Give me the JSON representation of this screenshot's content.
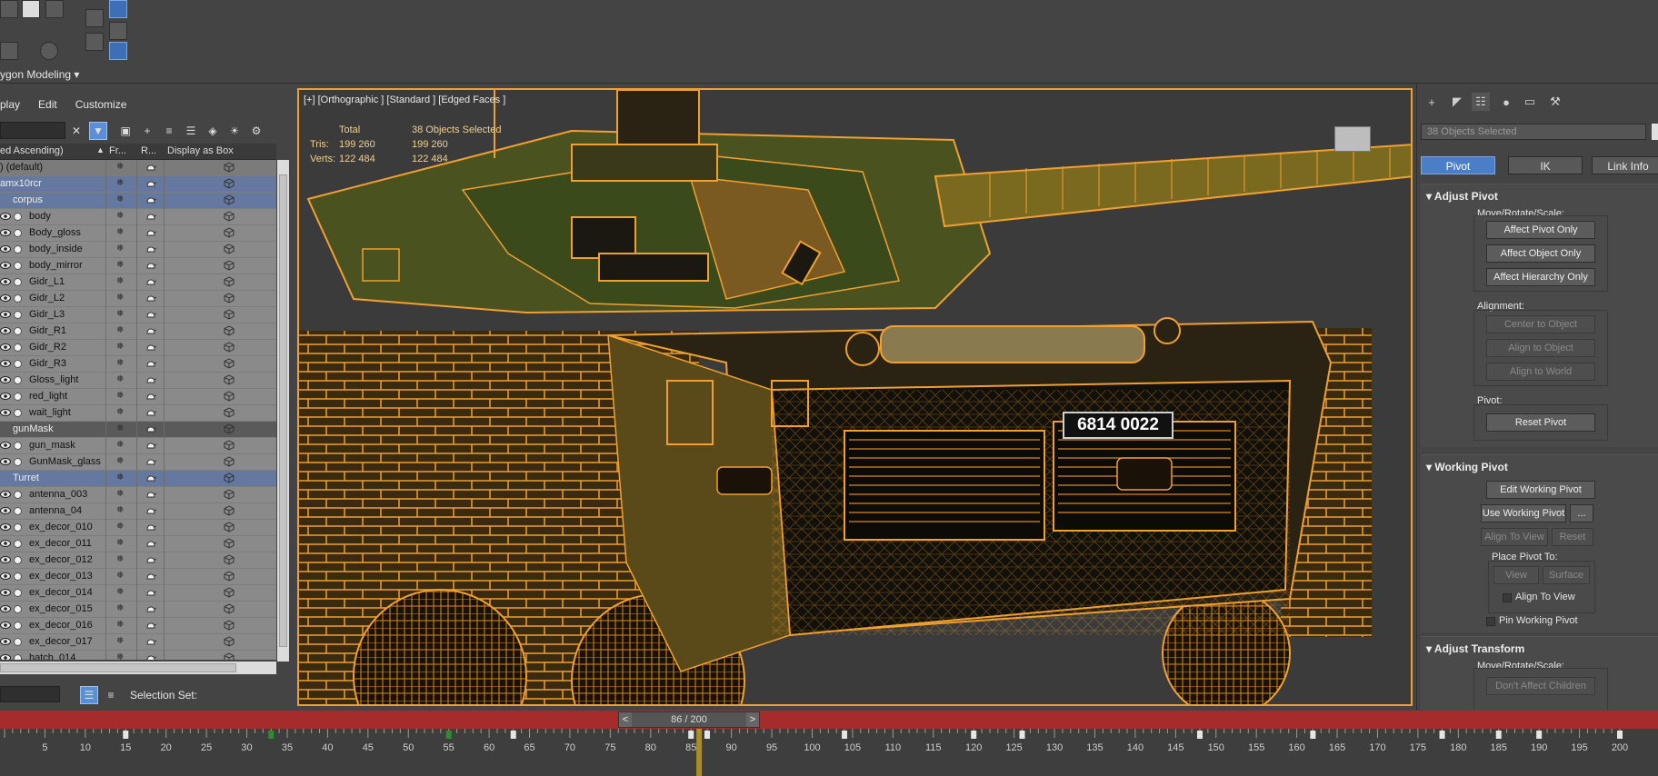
{
  "ribbon": {
    "label": "ygon Modeling",
    "dropdown_icon": "chevron-down-icon"
  },
  "menu": {
    "items": [
      "play",
      "Edit",
      "Customize"
    ]
  },
  "explorer": {
    "columns": [
      "ed Ascending)",
      "Fr...",
      "R...",
      "Display as Box"
    ],
    "rows": [
      {
        "name": ") (default)",
        "type": "layer"
      },
      {
        "name": "amx10rcr",
        "type": "sel"
      },
      {
        "name": "corpus",
        "type": "sel"
      },
      {
        "name": "body",
        "type": "obj"
      },
      {
        "name": "Body_gloss",
        "type": "obj"
      },
      {
        "name": "body_inside",
        "type": "obj"
      },
      {
        "name": "body_mirror",
        "type": "obj"
      },
      {
        "name": "Gidr_L1",
        "type": "obj"
      },
      {
        "name": "Gidr_L2",
        "type": "obj"
      },
      {
        "name": "Gidr_L3",
        "type": "obj"
      },
      {
        "name": "Gidr_R1",
        "type": "obj"
      },
      {
        "name": "Gidr_R2",
        "type": "obj"
      },
      {
        "name": "Gidr_R3",
        "type": "obj"
      },
      {
        "name": "Gloss_light",
        "type": "obj"
      },
      {
        "name": "red_light",
        "type": "obj"
      },
      {
        "name": "wait_light",
        "type": "obj"
      },
      {
        "name": "gunMask",
        "type": "dark"
      },
      {
        "name": "gun_mask",
        "type": "obj"
      },
      {
        "name": "GunMask_glass",
        "type": "obj"
      },
      {
        "name": "Turret",
        "type": "sel"
      },
      {
        "name": "antenna_003",
        "type": "obj"
      },
      {
        "name": "antenna_04",
        "type": "obj"
      },
      {
        "name": "ex_decor_010",
        "type": "obj"
      },
      {
        "name": "ex_decor_011",
        "type": "obj"
      },
      {
        "name": "ex_decor_012",
        "type": "obj"
      },
      {
        "name": "ex_decor_013",
        "type": "obj"
      },
      {
        "name": "ex_decor_014",
        "type": "obj"
      },
      {
        "name": "ex_decor_015",
        "type": "obj"
      },
      {
        "name": "ex_decor_016",
        "type": "obj"
      },
      {
        "name": "ex_decor_017",
        "type": "obj"
      },
      {
        "name": "hatch_014",
        "type": "obj"
      }
    ],
    "selection_set_label": "Selection Set:"
  },
  "viewport": {
    "label": "[+] [Orthographic ] [Standard ] [Edged Faces ]",
    "stats": {
      "total_label": "Total",
      "selected_label": "38 Objects Selected",
      "tris_label": "Tris:",
      "tris_total": "199 260",
      "tris_selected": "199 260",
      "verts_label": "Verts:",
      "verts_total": "122 484",
      "verts_selected": "122 484"
    },
    "plate_text": "6814 0022",
    "wire_color": "#f0a030"
  },
  "command_panel": {
    "name_field": "38 Objects Selected",
    "tabs": [
      "Pivot",
      "IK",
      "Link Info"
    ],
    "adjust_pivot": {
      "title": "Adjust Pivot",
      "move_label": "Move/Rotate/Scale:",
      "btn_pivot_only": "Affect Pivot Only",
      "btn_object_only": "Affect Object Only",
      "btn_hierarchy_only": "Affect Hierarchy Only",
      "alignment_label": "Alignment:",
      "btn_center": "Center to Object",
      "btn_align_object": "Align to Object",
      "btn_align_world": "Align to World",
      "pivot_label": "Pivot:",
      "btn_reset": "Reset Pivot"
    },
    "working_pivot": {
      "title": "Working Pivot",
      "btn_edit": "Edit Working Pivot",
      "btn_use": "Use Working Pivot",
      "btn_more": "...",
      "btn_align_view": "Align To View",
      "btn_reset": "Reset",
      "place_label": "Place Pivot To:",
      "btn_view": "View",
      "btn_surface": "Surface",
      "chk_align_view": "Align To View",
      "chk_pin": "Pin Working Pivot"
    },
    "adjust_transform": {
      "title": "Adjust Transform",
      "move_label": "Move/Rotate/Scale:",
      "btn_dont_affect": "Don't Affect Children"
    }
  },
  "timeline": {
    "frame_display": "86 / 200",
    "prev": "<",
    "next": ">",
    "ticks": [
      "5",
      "10",
      "15",
      "20",
      "25",
      "30",
      "35",
      "40",
      "45",
      "50",
      "55",
      "60",
      "65",
      "70",
      "75",
      "80",
      "85",
      "90",
      "95",
      "100",
      "105",
      "110",
      "115",
      "120",
      "125",
      "130",
      "135",
      "140",
      "145",
      "150",
      "155",
      "160",
      "165",
      "170",
      "175",
      "180",
      "185",
      "190",
      "195",
      "200"
    ],
    "current_frame": 86,
    "key_frames": [
      15,
      33,
      55,
      63,
      85,
      87,
      104,
      120,
      126,
      148,
      162,
      178,
      185,
      190,
      200
    ],
    "colors": {
      "bar": "#a62b2b",
      "current": "#c8a020"
    }
  }
}
